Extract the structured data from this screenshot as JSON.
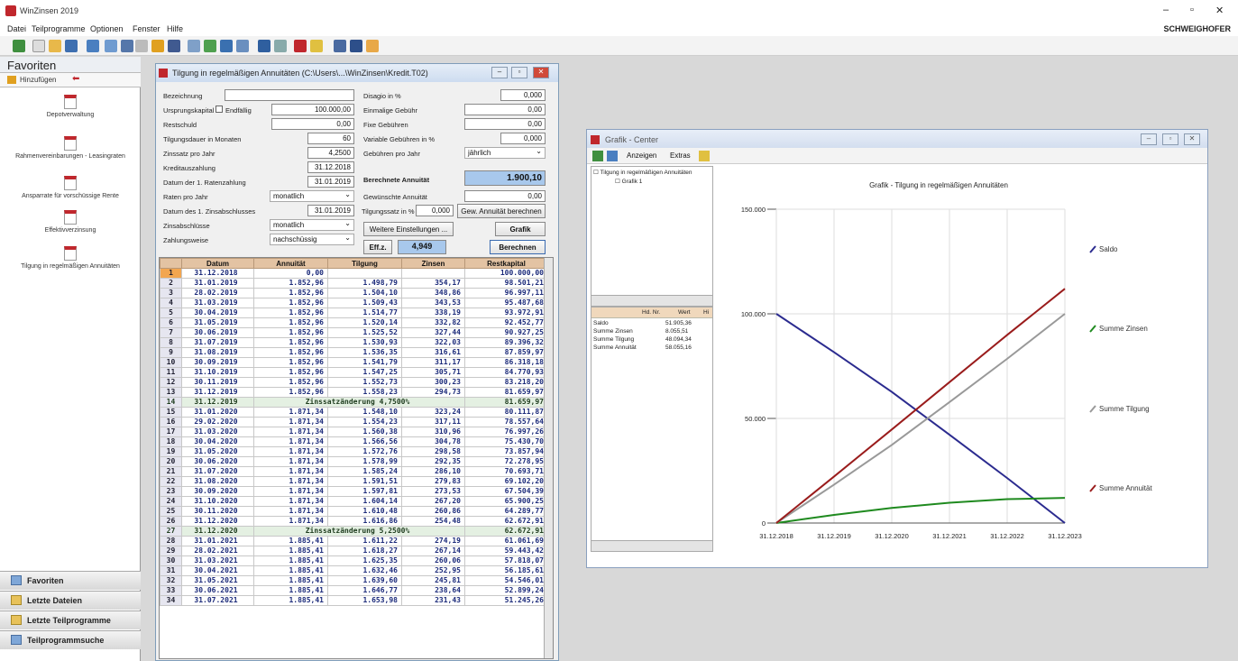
{
  "app": {
    "title": "WinZinsen 2019",
    "brand": "SCHWEIGHOFER"
  },
  "menu": [
    "Datei",
    "Teilprogramme",
    "Optionen",
    "Fenster",
    "Hilfe"
  ],
  "favorites": {
    "title": "Favoriten",
    "add_label": "Hinzufügen",
    "items": [
      "Depotverwaltung",
      "Rahmenvereinbarungen - Leasingraten",
      "Ansparrate für vorschüssige Rente",
      "Effektivverzinsung",
      "Tilgung in regelmäßigen Annuitäten"
    ],
    "nav": [
      "Favoriten",
      "Letzte Dateien",
      "Letzte Teilprogramme",
      "Teilprogrammsuche"
    ]
  },
  "tilgung": {
    "title": "Tilgung in regelmäßigen Annuitäten (C:\\Users\\...\\WinZinsen\\Kredit.T02)",
    "labels": {
      "bez": "Bezeichnung",
      "ursprung": "Ursprungskapital",
      "endfaellig": "Endfällig",
      "rest": "Restschuld",
      "dauer": "Tilgungsdauer in Monaten",
      "zins": "Zinssatz pro Jahr",
      "auszahlung": "Kreditauszahlung",
      "erste_rate": "Datum der 1. Ratenzahlung",
      "raten": "Raten pro Jahr",
      "erster_zins": "Datum des 1. Zinsabschlusses",
      "zinsabschl": "Zinsabschlüsse",
      "zahlungsweise": "Zahlungsweise",
      "disagio": "Disagio in %",
      "einmal": "Einmalige Gebühr",
      "fixe": "Fixe Gebühren",
      "variable": "Variable Gebühren in %",
      "gebuehren": "Gebühren pro Jahr",
      "berechnete": "Berechnete Annuität",
      "gewuenscht": "Gewünschte Annuität",
      "tilgsatz": "Tilgungssatz in %",
      "effz": "Eff.z."
    },
    "values": {
      "bez": "",
      "ursprung": "100.000,00",
      "rest": "0,00",
      "dauer": "60",
      "zins": "4,2500",
      "auszahlung": "31.12.2018",
      "erste_rate": "31.01.2019",
      "raten": "monatlich",
      "erster_zins": "31.01.2019",
      "zinsabschl": "monatlich",
      "zahlungsweise": "nachschüssig",
      "disagio": "0,000",
      "einmal": "0,00",
      "fixe": "0,00",
      "variable": "0,000",
      "gebuehren": "jährlich",
      "berechnete": "1.900,10",
      "gewuenscht": "0,00",
      "tilgsatz": "0,000",
      "effz": "4,949"
    },
    "buttons": {
      "gew": "Gew. Annuität berechnen",
      "weitere": "Weitere Einstellungen ...",
      "grafik": "Grafik",
      "berechnen": "Berechnen"
    },
    "columns": [
      "",
      "Datum",
      "Annuität",
      "Tilgung",
      "Zinsen",
      "Restkapital"
    ],
    "rows": [
      [
        "1",
        "31.12.2018",
        "0,00",
        "",
        "",
        "100.000,00"
      ],
      [
        "2",
        "31.01.2019",
        "1.852,96",
        "1.498,79",
        "354,17",
        "98.501,21"
      ],
      [
        "3",
        "28.02.2019",
        "1.852,96",
        "1.504,10",
        "348,86",
        "96.997,11"
      ],
      [
        "4",
        "31.03.2019",
        "1.852,96",
        "1.509,43",
        "343,53",
        "95.487,68"
      ],
      [
        "5",
        "30.04.2019",
        "1.852,96",
        "1.514,77",
        "338,19",
        "93.972,91"
      ],
      [
        "6",
        "31.05.2019",
        "1.852,96",
        "1.520,14",
        "332,82",
        "92.452,77"
      ],
      [
        "7",
        "30.06.2019",
        "1.852,96",
        "1.525,52",
        "327,44",
        "90.927,25"
      ],
      [
        "8",
        "31.07.2019",
        "1.852,96",
        "1.530,93",
        "322,03",
        "89.396,32"
      ],
      [
        "9",
        "31.08.2019",
        "1.852,96",
        "1.536,35",
        "316,61",
        "87.859,97"
      ],
      [
        "10",
        "30.09.2019",
        "1.852,96",
        "1.541,79",
        "311,17",
        "86.318,18"
      ],
      [
        "11",
        "31.10.2019",
        "1.852,96",
        "1.547,25",
        "305,71",
        "84.770,93"
      ],
      [
        "12",
        "30.11.2019",
        "1.852,96",
        "1.552,73",
        "300,23",
        "83.218,20"
      ],
      [
        "13",
        "31.12.2019",
        "1.852,96",
        "1.558,23",
        "294,73",
        "81.659,97"
      ],
      [
        "14",
        "31.12.2019",
        "Zinssatzänderung 4,7500%",
        "",
        "",
        "81.659,97"
      ],
      [
        "15",
        "31.01.2020",
        "1.871,34",
        "1.548,10",
        "323,24",
        "80.111,87"
      ],
      [
        "16",
        "29.02.2020",
        "1.871,34",
        "1.554,23",
        "317,11",
        "78.557,64"
      ],
      [
        "17",
        "31.03.2020",
        "1.871,34",
        "1.560,38",
        "310,96",
        "76.997,26"
      ],
      [
        "18",
        "30.04.2020",
        "1.871,34",
        "1.566,56",
        "304,78",
        "75.430,70"
      ],
      [
        "19",
        "31.05.2020",
        "1.871,34",
        "1.572,76",
        "298,58",
        "73.857,94"
      ],
      [
        "20",
        "30.06.2020",
        "1.871,34",
        "1.578,99",
        "292,35",
        "72.278,95"
      ],
      [
        "21",
        "31.07.2020",
        "1.871,34",
        "1.585,24",
        "286,10",
        "70.693,71"
      ],
      [
        "22",
        "31.08.2020",
        "1.871,34",
        "1.591,51",
        "279,83",
        "69.102,20"
      ],
      [
        "23",
        "30.09.2020",
        "1.871,34",
        "1.597,81",
        "273,53",
        "67.504,39"
      ],
      [
        "24",
        "31.10.2020",
        "1.871,34",
        "1.604,14",
        "267,20",
        "65.900,25"
      ],
      [
        "25",
        "30.11.2020",
        "1.871,34",
        "1.610,48",
        "260,86",
        "64.289,77"
      ],
      [
        "26",
        "31.12.2020",
        "1.871,34",
        "1.616,86",
        "254,48",
        "62.672,91"
      ],
      [
        "27",
        "31.12.2020",
        "Zinssatzänderung 5,2500%",
        "",
        "",
        "62.672,91"
      ],
      [
        "28",
        "31.01.2021",
        "1.885,41",
        "1.611,22",
        "274,19",
        "61.061,69"
      ],
      [
        "29",
        "28.02.2021",
        "1.885,41",
        "1.618,27",
        "267,14",
        "59.443,42"
      ],
      [
        "30",
        "31.03.2021",
        "1.885,41",
        "1.625,35",
        "260,06",
        "57.818,07"
      ],
      [
        "31",
        "30.04.2021",
        "1.885,41",
        "1.632,46",
        "252,95",
        "56.185,61"
      ],
      [
        "32",
        "31.05.2021",
        "1.885,41",
        "1.639,60",
        "245,81",
        "54.546,01"
      ],
      [
        "33",
        "30.06.2021",
        "1.885,41",
        "1.646,77",
        "238,64",
        "52.899,24"
      ],
      [
        "34",
        "31.07.2021",
        "1.885,41",
        "1.653,98",
        "231,43",
        "51.245,26"
      ]
    ]
  },
  "grafik": {
    "title": "Grafik - Center",
    "menu": [
      "Anzeigen",
      "Extras"
    ],
    "tree": [
      "Tilgung in regelmäßigen Annuitäten",
      "Grafik 1"
    ],
    "stats_cols": [
      "Hd. Nr.",
      "Wert",
      "Hi"
    ],
    "stats": [
      [
        "Saldo",
        "51.905,36"
      ],
      [
        "Summe Zinsen",
        "8.055,51"
      ],
      [
        "Summe Tilgung",
        "48.094,34"
      ],
      [
        "Summe Annuität",
        "58.055,16"
      ]
    ]
  },
  "chart_data": {
    "type": "line",
    "title": "Grafik - Tilgung in regelmäßigen Annuitäten",
    "x": [
      "31.12.2018",
      "31.12.2019",
      "31.12.2020",
      "31.12.2021",
      "31.12.2022",
      "31.12.2023"
    ],
    "ylim": [
      0,
      150000
    ],
    "yticks": [
      "0",
      "50.000",
      "100.000",
      "150.000"
    ],
    "series": [
      {
        "name": "Saldo",
        "color": "#2b2b8f",
        "values": [
          100000,
          81660,
          62673,
          42200,
          21500,
          0
        ]
      },
      {
        "name": "Summe Zinsen",
        "color": "#1f8a1f",
        "values": [
          0,
          3900,
          7200,
          9700,
          11400,
          12000
        ]
      },
      {
        "name": "Summe Tilgung",
        "color": "#999999",
        "values": [
          0,
          18340,
          37327,
          57800,
          78500,
          100000
        ]
      },
      {
        "name": "Summe Annuität",
        "color": "#9a1c1c",
        "values": [
          0,
          22235,
          44691,
          67330,
          89900,
          112000
        ]
      }
    ]
  }
}
